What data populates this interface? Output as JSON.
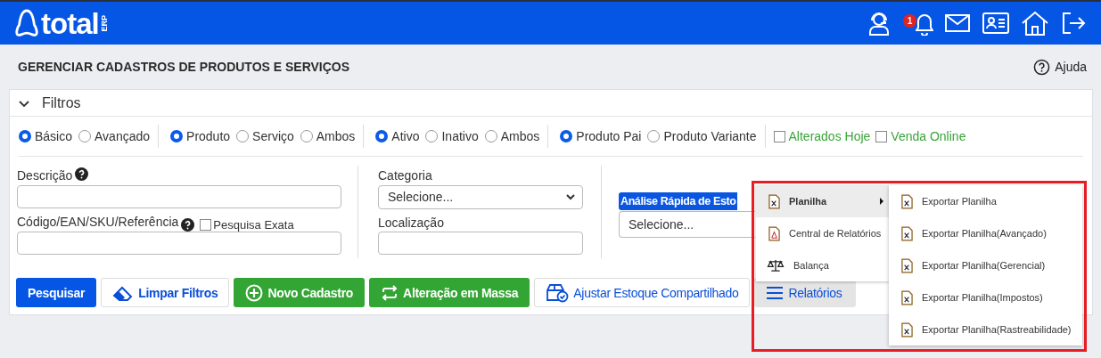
{
  "header": {
    "logo": "total",
    "logo_suffix": "ERP",
    "notification_count": "1"
  },
  "page": {
    "title": "GERENCIAR CADASTROS DE PRODUTOS E SERVIÇOS",
    "help": "Ajuda"
  },
  "filters": {
    "title": "Filtros",
    "expanded": true,
    "radio_groups": [
      [
        {
          "label": "Básico",
          "selected": true
        },
        {
          "label": "Avançado",
          "selected": false
        }
      ],
      [
        {
          "label": "Produto",
          "selected": true
        },
        {
          "label": "Serviço",
          "selected": false
        },
        {
          "label": "Ambos",
          "selected": false
        }
      ],
      [
        {
          "label": "Ativo",
          "selected": true
        },
        {
          "label": "Inativo",
          "selected": false
        },
        {
          "label": "Ambos",
          "selected": false
        }
      ],
      [
        {
          "label": "Produto Pai",
          "selected": true
        },
        {
          "label": "Produto Variante",
          "selected": false
        }
      ]
    ],
    "checkboxes": [
      {
        "label": "Alterados Hoje",
        "checked": false
      },
      {
        "label": "Venda Online",
        "checked": false
      }
    ]
  },
  "form": {
    "descricao": {
      "label": "Descrição"
    },
    "codigo": {
      "label": "Código/EAN/SKU/Referência",
      "exact_label": "Pesquisa Exata",
      "exact_checked": false
    },
    "categoria": {
      "label": "Categoria",
      "value": "Selecione..."
    },
    "localizacao": {
      "label": "Localização"
    },
    "analise": {
      "label": "Análise Rápida de Esto",
      "value": "Selecione..."
    }
  },
  "buttons": [
    {
      "label": "Pesquisar",
      "kind": "primary"
    },
    {
      "label": "Limpar Filtros",
      "kind": "eraser"
    },
    {
      "label": "Novo Cadastro",
      "kind": "add"
    },
    {
      "label": "Alteração em Massa",
      "kind": "bulk"
    },
    {
      "label": "Ajustar Estoque Compartilhado",
      "kind": "stock"
    },
    {
      "label": "Relatórios",
      "kind": "menu"
    }
  ],
  "menu": {
    "items": [
      {
        "label": "Planilha",
        "kind": "sheet",
        "selected": true,
        "submenu": true
      },
      {
        "label": "Central de Relatórios",
        "kind": "pdf",
        "selected": false,
        "submenu": false
      },
      {
        "label": "Balança",
        "kind": "scale",
        "selected": false,
        "submenu": false
      }
    ],
    "submenu": [
      "Exportar Planilha",
      "Exportar Planilha(Avançado)",
      "Exportar Planilha(Gerencial)",
      "Exportar Planilha(Impostos)",
      "Exportar Planilha(Rastreabilidade)"
    ]
  }
}
